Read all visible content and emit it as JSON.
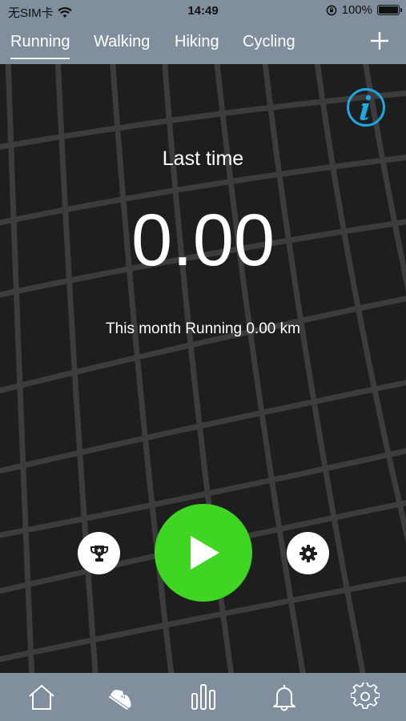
{
  "status_bar": {
    "carrier": "无SIM卡",
    "time": "14:49",
    "battery": "100%"
  },
  "tabs": [
    {
      "label": "Running",
      "active": true
    },
    {
      "label": "Walking",
      "active": false
    },
    {
      "label": "Hiking",
      "active": false
    },
    {
      "label": "Cycling",
      "active": false
    }
  ],
  "main": {
    "last_label": "Last time",
    "last_value": "0.00",
    "month_text": "This month Running 0.00 km"
  },
  "buttons": {
    "trophy_icon": "trophy-icon",
    "play_icon": "play-icon",
    "settings_icon": "gear-icon",
    "info_icon": "info-icon"
  },
  "bottom_nav": [
    "home-icon",
    "shoe-icon",
    "bar-chart-icon",
    "bell-icon",
    "gear-icon"
  ],
  "colors": {
    "header": "#818e9d",
    "map_background": "#1e1e1f",
    "map_streets": "#3c3c3e",
    "play_button": "#3ed523",
    "info_accent": "#1ea6e0"
  }
}
